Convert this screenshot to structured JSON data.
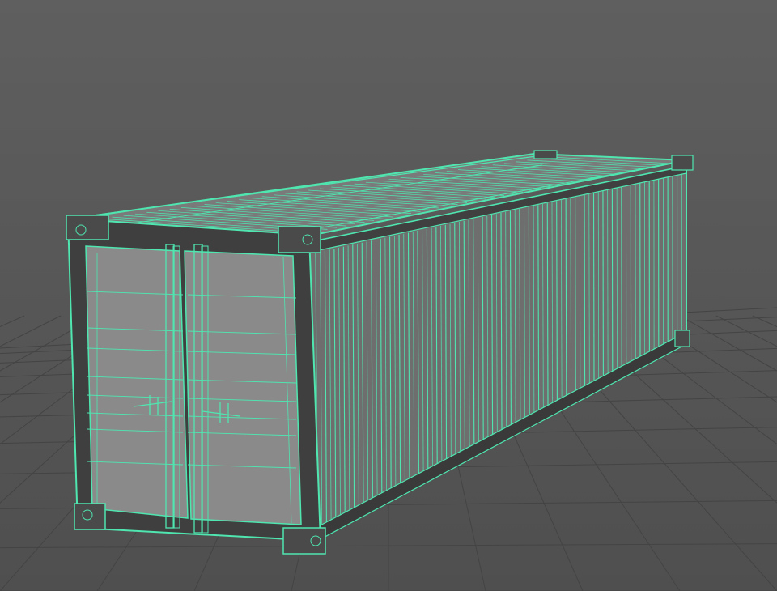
{
  "viewport": {
    "background_color": "#5d5d5d",
    "grid_color": "#444444",
    "wireframe_color": "#4fe6b0",
    "shaded_color": "#8a8a8a",
    "display_mode": "wireframe-on-shaded"
  },
  "scene": {
    "object": "shipping-container-40ft",
    "selected": true,
    "components": [
      "container-body",
      "roof-panel",
      "side-corrugation",
      "door-left",
      "door-right",
      "lock-rods",
      "door-handles",
      "corner-castings"
    ]
  }
}
